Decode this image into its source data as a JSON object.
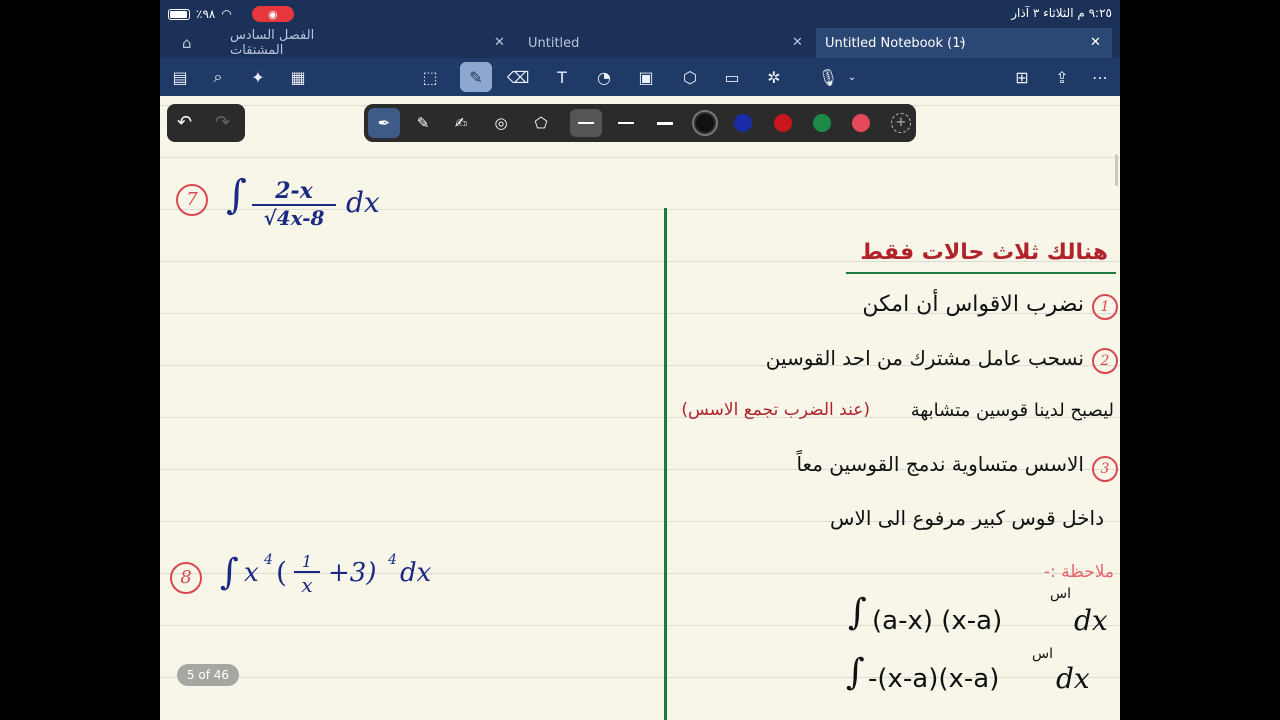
{
  "status": {
    "battery": "٪٩٨",
    "datetime": "٩:٢٥ م  الثلاثاء ٣ آذار"
  },
  "tabs": [
    {
      "label": "الفصل السادس المشتقات",
      "active": false
    },
    {
      "label": "Untitled",
      "active": false
    },
    {
      "label": "Untitled Notebook (1)",
      "active": true
    }
  ],
  "page_indicator": "5 of 46",
  "notes": {
    "q7": {
      "num": "7",
      "numerator": "2-x",
      "denominator": "4x-8",
      "tail": "dx"
    },
    "q8": {
      "num": "8",
      "expr_a": "x",
      "exp1": "4",
      "frac_num": "1",
      "frac_den": "x",
      "expr_b": "+3)",
      "exp2": "4",
      "tail": "dx"
    },
    "right": {
      "heading": "هنالك ثلاث حالات فقط",
      "item1_num": "1",
      "item1": "نضرب الاقواس أن امكن",
      "item2_num": "2",
      "item2": "نسحب عامل مشترك من احد القوسين",
      "item2b": "ليصبح لدينا قوسين متشابهة",
      "item2b_note": "(عند الضرب تجمع الاسس)",
      "item3_num": "3",
      "item3": "الاسس متساوية ندمج القوسين معاً",
      "item3b": "داخل قوس كبير مرفوع الى الاس",
      "note_label": "ملاحظة :-",
      "formula1": "(a-x) (x-a)",
      "formula1_exp": "اس",
      "formula2": "-(x-a)(x-a)",
      "formula2_exp": "اس",
      "formula_tail": "dx"
    }
  },
  "colors": {
    "ink_blue": "#1a2a82",
    "ink_red": "#b0232b",
    "ink_pink": "#d9484f",
    "divider_green": "#1c7a3e",
    "tab_bar": "#1b3158",
    "toolbar": "#1f3a66"
  },
  "pen_palette": {
    "swatches": [
      "#111111",
      "#1a2ba8",
      "#c8161d",
      "#1d8a4a",
      "#e5485a"
    ]
  }
}
